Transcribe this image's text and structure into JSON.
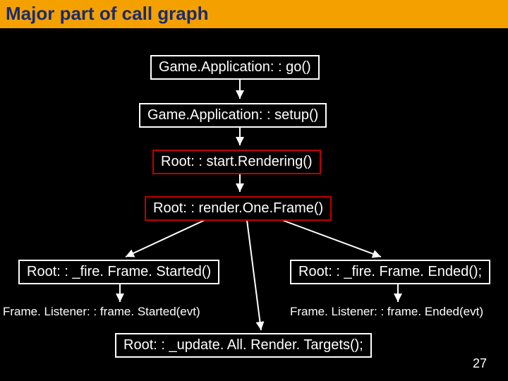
{
  "title": "Major part of call graph",
  "nodes": {
    "go": "Game.Application: : go()",
    "setup": "Game.Application: : setup()",
    "startR": "Root: : start.Rendering()",
    "renderOne": "Root: : render.One.Frame()",
    "fireStart": "Root: : _fire. Frame. Started()",
    "fireEnd": "Root: : _fire. Frame. Ended();",
    "update": "Root: : _update. All. Render. Targets();"
  },
  "leaves": {
    "frameStarted": "Frame. Listener: : frame. Started(evt)",
    "frameEnded": "Frame. Listener: : frame. Ended(evt)"
  },
  "page": "27"
}
